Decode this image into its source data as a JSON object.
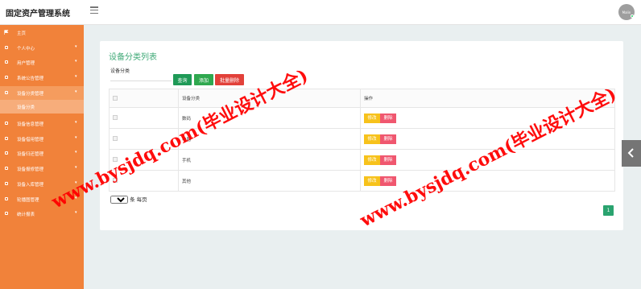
{
  "app": {
    "title": "固定资产管理系统",
    "user_initials": "Malin"
  },
  "sidebar": {
    "items": [
      {
        "label": "主页",
        "caret": ""
      },
      {
        "label": "个人中心",
        "caret": "▾"
      },
      {
        "label": "用户管理",
        "caret": "▾"
      },
      {
        "label": "系统公告管理",
        "caret": "▾"
      },
      {
        "label": "设备分类管理",
        "caret": "▾"
      },
      {
        "label": "设备信息管理",
        "caret": "▾"
      },
      {
        "label": "设备借用管理",
        "caret": "▾"
      },
      {
        "label": "设备归还管理",
        "caret": "▾"
      },
      {
        "label": "设备报修管理",
        "caret": "▾"
      },
      {
        "label": "设备入库管理",
        "caret": "▾"
      },
      {
        "label": "轮播图管理",
        "caret": "▾"
      },
      {
        "label": "统计报表",
        "caret": "▾"
      }
    ],
    "sub_item": "设备分类"
  },
  "page": {
    "title": "设备分类列表",
    "filter_label": "设备分类",
    "filter_value": "",
    "buttons": {
      "query": "查询",
      "add": "添加",
      "bulk_delete": "批量删除"
    },
    "table": {
      "headers": [
        "",
        "设备分类",
        "操作"
      ],
      "rows": [
        {
          "name": "数码"
        },
        {
          "name": "电器"
        },
        {
          "name": "手机"
        },
        {
          "name": "其他"
        }
      ],
      "edit_label": "修改",
      "delete_label": "删除"
    },
    "page_size": "10",
    "page_size_suffix": "条 每页",
    "current_page": "1"
  },
  "watermark": "www.bysjdq.com(毕业设计大全)",
  "colors": {
    "sidebar": "#f1823a",
    "title_green": "#3fa977",
    "watermark": "#ff0000"
  }
}
